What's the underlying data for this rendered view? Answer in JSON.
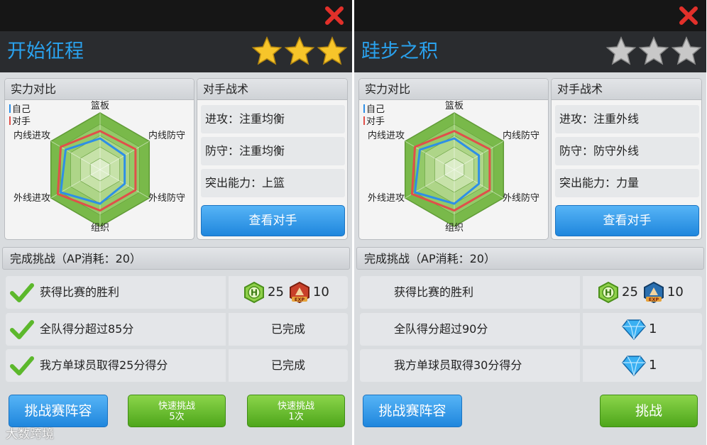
{
  "panels": [
    {
      "title": "开始征程",
      "stars_earned": 3,
      "stars_total": 3,
      "strength_title": "实力对比",
      "legend_self": "自己",
      "legend_opponent": "对手",
      "radar_labels": [
        "篮板",
        "内线防守",
        "外线防守",
        "组织",
        "外线进攻",
        "内线进攻"
      ],
      "radar_self": [
        0.55,
        0.5,
        0.5,
        0.6,
        0.8,
        0.7
      ],
      "radar_opponent": [
        0.68,
        0.72,
        0.72,
        0.72,
        0.86,
        0.8
      ],
      "tactics_title": "对手战术",
      "tactics": [
        "进攻：注重均衡",
        "防守：注重均衡",
        "突出能力：上篮"
      ],
      "view_opponent_label": "查看对手",
      "challenge_title": "完成挑战（AP消耗：20）",
      "tasks": [
        {
          "text": "获得比赛的胜利",
          "done": true,
          "reward_coin": "25",
          "reward_exp": "10"
        },
        {
          "text": "全队得分超过85分",
          "done": true,
          "status": "已完成"
        },
        {
          "text": "我方单球员取得25分得分",
          "done": true,
          "status": "已完成"
        }
      ],
      "lineup_label": "挑战赛阵容",
      "quick5_line1": "快速挑战",
      "quick5_line2": "5次",
      "quick1_line1": "快速挑战",
      "quick1_line2": "1次",
      "watermark": "大数跨境"
    },
    {
      "title": "跬步之积",
      "stars_earned": 0,
      "stars_total": 3,
      "strength_title": "实力对比",
      "legend_self": "自己",
      "legend_opponent": "对手",
      "radar_labels": [
        "篮板",
        "内线防守",
        "外线防守",
        "组织",
        "外线进攻",
        "内线进攻"
      ],
      "radar_self": [
        0.55,
        0.5,
        0.5,
        0.6,
        0.8,
        0.7
      ],
      "radar_opponent": [
        0.68,
        0.72,
        0.72,
        0.72,
        0.86,
        0.8
      ],
      "tactics_title": "对手战术",
      "tactics": [
        "进攻：注重外线",
        "防守：防守外线",
        "突出能力：力量"
      ],
      "view_opponent_label": "查看对手",
      "challenge_title": "完成挑战（AP消耗：20）",
      "tasks": [
        {
          "text": "获得比赛的胜利",
          "done": false,
          "reward_coin": "25",
          "reward_exp": "10"
        },
        {
          "text": "全队得分超过90分",
          "done": false,
          "reward_diamond": "1"
        },
        {
          "text": "我方单球员取得30分得分",
          "done": false,
          "reward_diamond": "1"
        }
      ],
      "lineup_label": "挑战赛阵容",
      "challenge_label": "挑战"
    }
  ],
  "colors": {
    "title_blue": "#2aa2ee",
    "star_gold": "#f7c52a",
    "star_gray": "#c8c8c8",
    "self_line": "#2e8fe6",
    "opponent_line": "#e0504a",
    "radar_green": "#7cc04a"
  }
}
